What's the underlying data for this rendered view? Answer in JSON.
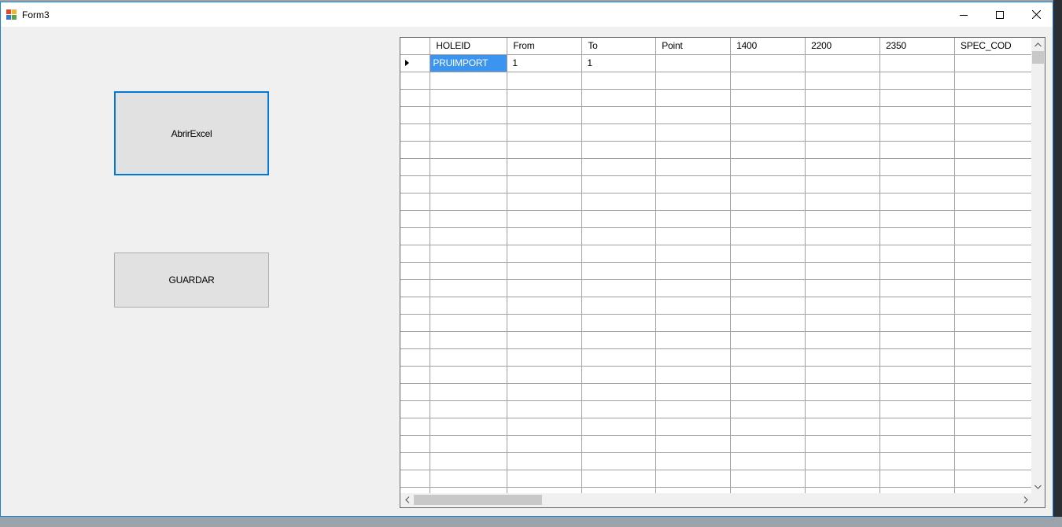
{
  "window": {
    "title": "Form3"
  },
  "buttons": {
    "open_excel": "AbrirExcel",
    "save": "GUARDAR"
  },
  "grid": {
    "columns": [
      "HOLEID",
      "From",
      "To",
      "Point",
      "1400",
      "2200",
      "2350",
      "SPEC_COD"
    ],
    "rows": [
      [
        "PRUIMPORT",
        "1",
        "1",
        "",
        "",
        "",
        "",
        ""
      ]
    ]
  },
  "colors": {
    "selection": "#3a94f0",
    "focus_border": "#0078d7"
  }
}
